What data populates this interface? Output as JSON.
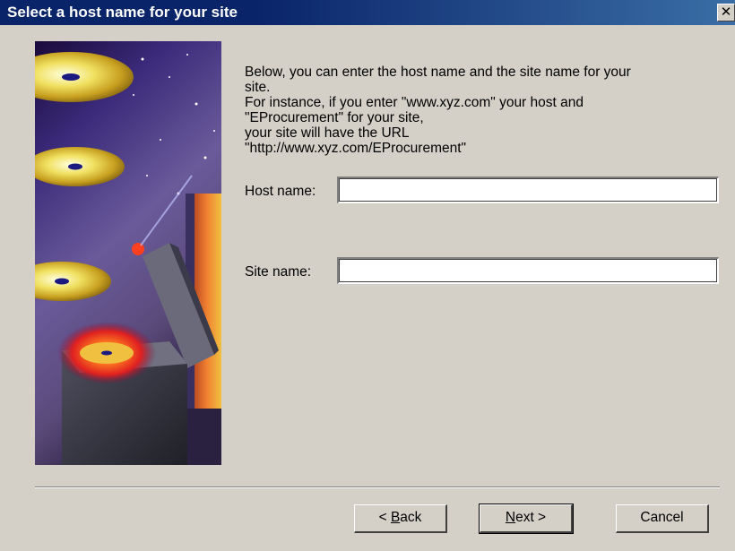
{
  "window": {
    "title": "Select a host name for your site",
    "close_glyph": "✕"
  },
  "description": {
    "lines": [
      "Below, you can enter the host name and the site name  for your",
      "site.",
      "For instance, if you enter \"www.xyz.com\" your host and",
      "\"EProcurement\" for your site,",
      "your site will have the URL",
      "\"http://www.xyz.com/EProcurement\""
    ]
  },
  "fields": {
    "host": {
      "label": "Host name:",
      "value": ""
    },
    "site": {
      "label": "Site name:",
      "value": ""
    }
  },
  "buttons": {
    "back": {
      "prefix": "< ",
      "accel": "B",
      "rest": "ack"
    },
    "next": {
      "prefix": "",
      "accel": "N",
      "rest": "ext >"
    },
    "cancel": {
      "label": "Cancel"
    }
  },
  "illustration": {
    "icon": "cd-discs-illustration"
  }
}
